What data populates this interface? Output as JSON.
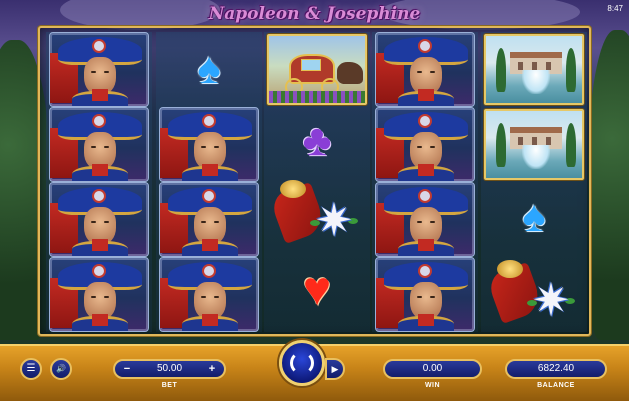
{
  "game": {
    "title": "Napoleon & Josephine",
    "clock": "8:47"
  },
  "icons": {
    "menu": "☰",
    "sound": "🔊",
    "autoplay": "▶",
    "spin": "spin-arrows",
    "spade": "♠",
    "club": "♣",
    "heart": "♥",
    "medal_star": "✷"
  },
  "reels": [
    [
      "napoleon",
      "napoleon",
      "napoleon",
      "napoleon"
    ],
    [
      "blue-spade",
      "napoleon",
      "napoleon",
      "napoleon"
    ],
    [
      "carriage",
      "purple-club",
      "medal",
      "red-heart"
    ],
    [
      "napoleon",
      "napoleon",
      "napoleon",
      "napoleon"
    ],
    [
      "fountain",
      "fountain",
      "blue-spade",
      "medal"
    ]
  ],
  "controls": {
    "bet_value": "50.00",
    "bet_minus": "−",
    "bet_plus": "+",
    "bet_label": "BET",
    "win_value": "0.00",
    "win_label": "WIN",
    "balance_value": "6822.40",
    "balance_label": "BALANCE"
  },
  "colors": {
    "frame_gold": "#e0b75a",
    "bar_orange": "#c88418",
    "pill_blue": "#131d6a",
    "title_pink": "#d98bd6"
  }
}
